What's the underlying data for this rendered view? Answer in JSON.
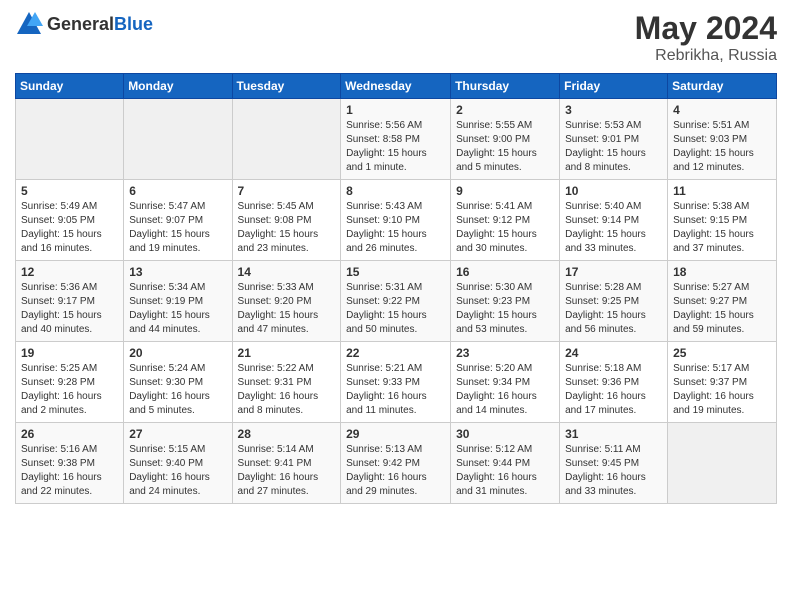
{
  "header": {
    "logo_general": "General",
    "logo_blue": "Blue",
    "title": "May 2024",
    "location": "Rebrikha, Russia"
  },
  "weekdays": [
    "Sunday",
    "Monday",
    "Tuesday",
    "Wednesday",
    "Thursday",
    "Friday",
    "Saturday"
  ],
  "weeks": [
    [
      {
        "day": "",
        "info": ""
      },
      {
        "day": "",
        "info": ""
      },
      {
        "day": "",
        "info": ""
      },
      {
        "day": "1",
        "info": "Sunrise: 5:56 AM\nSunset: 8:58 PM\nDaylight: 15 hours\nand 1 minute."
      },
      {
        "day": "2",
        "info": "Sunrise: 5:55 AM\nSunset: 9:00 PM\nDaylight: 15 hours\nand 5 minutes."
      },
      {
        "day": "3",
        "info": "Sunrise: 5:53 AM\nSunset: 9:01 PM\nDaylight: 15 hours\nand 8 minutes."
      },
      {
        "day": "4",
        "info": "Sunrise: 5:51 AM\nSunset: 9:03 PM\nDaylight: 15 hours\nand 12 minutes."
      }
    ],
    [
      {
        "day": "5",
        "info": "Sunrise: 5:49 AM\nSunset: 9:05 PM\nDaylight: 15 hours\nand 16 minutes."
      },
      {
        "day": "6",
        "info": "Sunrise: 5:47 AM\nSunset: 9:07 PM\nDaylight: 15 hours\nand 19 minutes."
      },
      {
        "day": "7",
        "info": "Sunrise: 5:45 AM\nSunset: 9:08 PM\nDaylight: 15 hours\nand 23 minutes."
      },
      {
        "day": "8",
        "info": "Sunrise: 5:43 AM\nSunset: 9:10 PM\nDaylight: 15 hours\nand 26 minutes."
      },
      {
        "day": "9",
        "info": "Sunrise: 5:41 AM\nSunset: 9:12 PM\nDaylight: 15 hours\nand 30 minutes."
      },
      {
        "day": "10",
        "info": "Sunrise: 5:40 AM\nSunset: 9:14 PM\nDaylight: 15 hours\nand 33 minutes."
      },
      {
        "day": "11",
        "info": "Sunrise: 5:38 AM\nSunset: 9:15 PM\nDaylight: 15 hours\nand 37 minutes."
      }
    ],
    [
      {
        "day": "12",
        "info": "Sunrise: 5:36 AM\nSunset: 9:17 PM\nDaylight: 15 hours\nand 40 minutes."
      },
      {
        "day": "13",
        "info": "Sunrise: 5:34 AM\nSunset: 9:19 PM\nDaylight: 15 hours\nand 44 minutes."
      },
      {
        "day": "14",
        "info": "Sunrise: 5:33 AM\nSunset: 9:20 PM\nDaylight: 15 hours\nand 47 minutes."
      },
      {
        "day": "15",
        "info": "Sunrise: 5:31 AM\nSunset: 9:22 PM\nDaylight: 15 hours\nand 50 minutes."
      },
      {
        "day": "16",
        "info": "Sunrise: 5:30 AM\nSunset: 9:23 PM\nDaylight: 15 hours\nand 53 minutes."
      },
      {
        "day": "17",
        "info": "Sunrise: 5:28 AM\nSunset: 9:25 PM\nDaylight: 15 hours\nand 56 minutes."
      },
      {
        "day": "18",
        "info": "Sunrise: 5:27 AM\nSunset: 9:27 PM\nDaylight: 15 hours\nand 59 minutes."
      }
    ],
    [
      {
        "day": "19",
        "info": "Sunrise: 5:25 AM\nSunset: 9:28 PM\nDaylight: 16 hours\nand 2 minutes."
      },
      {
        "day": "20",
        "info": "Sunrise: 5:24 AM\nSunset: 9:30 PM\nDaylight: 16 hours\nand 5 minutes."
      },
      {
        "day": "21",
        "info": "Sunrise: 5:22 AM\nSunset: 9:31 PM\nDaylight: 16 hours\nand 8 minutes."
      },
      {
        "day": "22",
        "info": "Sunrise: 5:21 AM\nSunset: 9:33 PM\nDaylight: 16 hours\nand 11 minutes."
      },
      {
        "day": "23",
        "info": "Sunrise: 5:20 AM\nSunset: 9:34 PM\nDaylight: 16 hours\nand 14 minutes."
      },
      {
        "day": "24",
        "info": "Sunrise: 5:18 AM\nSunset: 9:36 PM\nDaylight: 16 hours\nand 17 minutes."
      },
      {
        "day": "25",
        "info": "Sunrise: 5:17 AM\nSunset: 9:37 PM\nDaylight: 16 hours\nand 19 minutes."
      }
    ],
    [
      {
        "day": "26",
        "info": "Sunrise: 5:16 AM\nSunset: 9:38 PM\nDaylight: 16 hours\nand 22 minutes."
      },
      {
        "day": "27",
        "info": "Sunrise: 5:15 AM\nSunset: 9:40 PM\nDaylight: 16 hours\nand 24 minutes."
      },
      {
        "day": "28",
        "info": "Sunrise: 5:14 AM\nSunset: 9:41 PM\nDaylight: 16 hours\nand 27 minutes."
      },
      {
        "day": "29",
        "info": "Sunrise: 5:13 AM\nSunset: 9:42 PM\nDaylight: 16 hours\nand 29 minutes."
      },
      {
        "day": "30",
        "info": "Sunrise: 5:12 AM\nSunset: 9:44 PM\nDaylight: 16 hours\nand 31 minutes."
      },
      {
        "day": "31",
        "info": "Sunrise: 5:11 AM\nSunset: 9:45 PM\nDaylight: 16 hours\nand 33 minutes."
      },
      {
        "day": "",
        "info": ""
      }
    ]
  ]
}
